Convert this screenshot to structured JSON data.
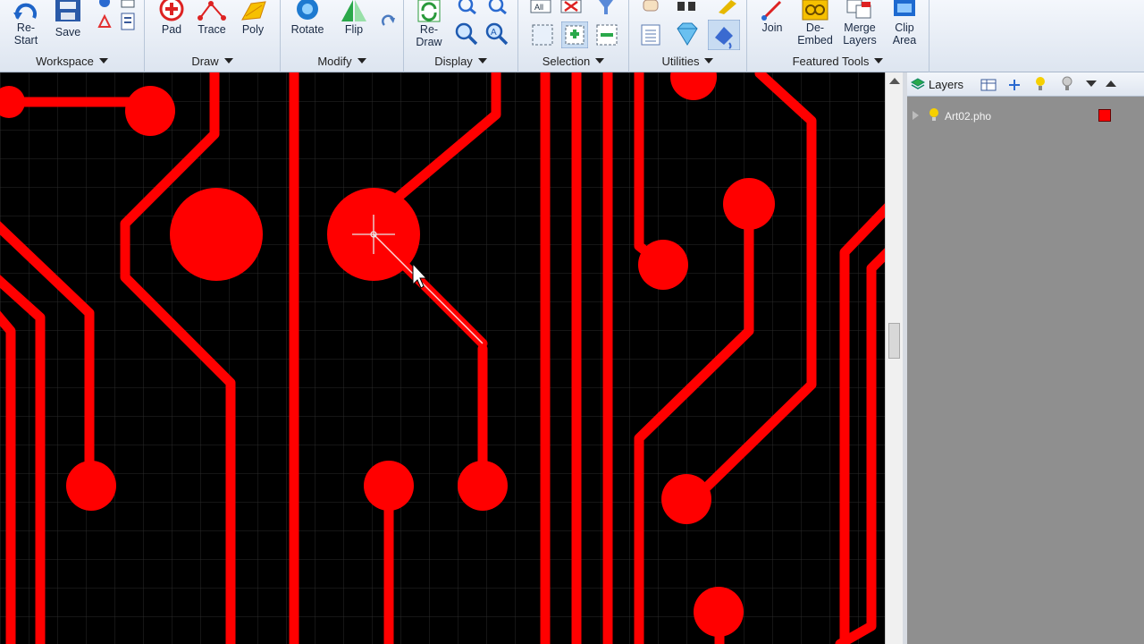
{
  "ribbon": {
    "groups": [
      {
        "label": "Workspace"
      },
      {
        "label": "Draw"
      },
      {
        "label": "Modify"
      },
      {
        "label": "Display"
      },
      {
        "label": "Selection"
      },
      {
        "label": "Utilities"
      },
      {
        "label": "Featured Tools"
      }
    ],
    "buttons": {
      "restart": "Re-\nStart",
      "save": "Save",
      "pad": "Pad",
      "trace": "Trace",
      "poly": "Poly",
      "rotate": "Rotate",
      "flip": "Flip",
      "redraw": "Re-\nDraw",
      "join": "Join",
      "deembed": "De-\nEmbed",
      "merge_layers": "Merge\nLayers",
      "clip_area": "Clip\nArea"
    }
  },
  "layers_panel": {
    "title": "Layers",
    "layers": [
      {
        "name": "Art02.pho",
        "color": "#ff0000"
      }
    ]
  },
  "canvas": {
    "background": "#000000",
    "copper_color": "#ff0000"
  }
}
